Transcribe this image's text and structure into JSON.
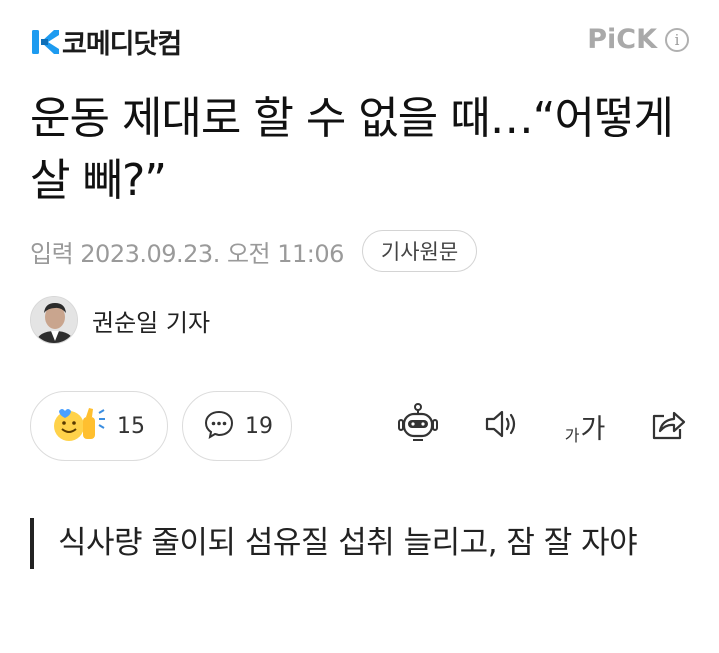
{
  "header": {
    "logo_text": "코메디닷컴",
    "pick_label": "PiCK",
    "info_glyph": "i",
    "logo_color": "#1d9bf0"
  },
  "article": {
    "headline": "운동 제대로 할 수 없을 때…“어떻게 살 빼?”",
    "date": "입력 2023.09.23. 오전 11:06",
    "original_button": "기사원문",
    "author": "권순일 기자"
  },
  "actions": {
    "reactions_count": "15",
    "comments_count": "19",
    "font_size_small": "가",
    "font_size_large": "가",
    "icons": [
      "reaction-emoji-icon",
      "comment-icon",
      "robot-summary-icon",
      "speaker-icon",
      "font-size-icon",
      "share-icon"
    ]
  },
  "subheadline": "식사량 줄이되 섬유질 섭취 늘리고, 잠 잘 자야"
}
